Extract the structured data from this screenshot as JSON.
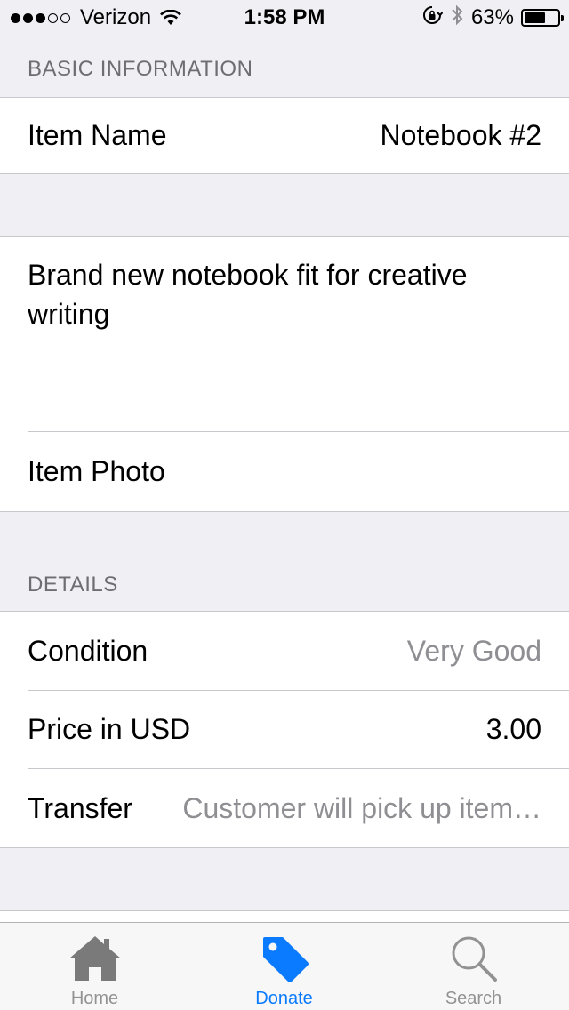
{
  "status_bar": {
    "carrier": "Verizon",
    "time": "1:58 PM",
    "battery_percent": "63%",
    "battery_level": 0.63,
    "signal_strength": 3,
    "signal_total": 5
  },
  "sections": {
    "basic": {
      "header": "BASIC INFORMATION",
      "item_name_label": "Item Name",
      "item_name_value": "Notebook #2",
      "description": "Brand new notebook fit for creative writing",
      "item_photo_label": "Item Photo"
    },
    "details": {
      "header": "DETAILS",
      "condition_label": "Condition",
      "condition_value": "Very Good",
      "price_label": "Price in USD",
      "price_value": "3.00",
      "transfer_label": "Transfer",
      "transfer_value": "Customer will pick up item…"
    }
  },
  "tab_bar": {
    "tabs": [
      {
        "label": "Home",
        "icon": "home-icon",
        "active": false
      },
      {
        "label": "Donate",
        "icon": "tag-icon",
        "active": true
      },
      {
        "label": "Search",
        "icon": "search-icon",
        "active": false
      }
    ],
    "active_color": "#0a7aff",
    "inactive_color": "#929292"
  }
}
